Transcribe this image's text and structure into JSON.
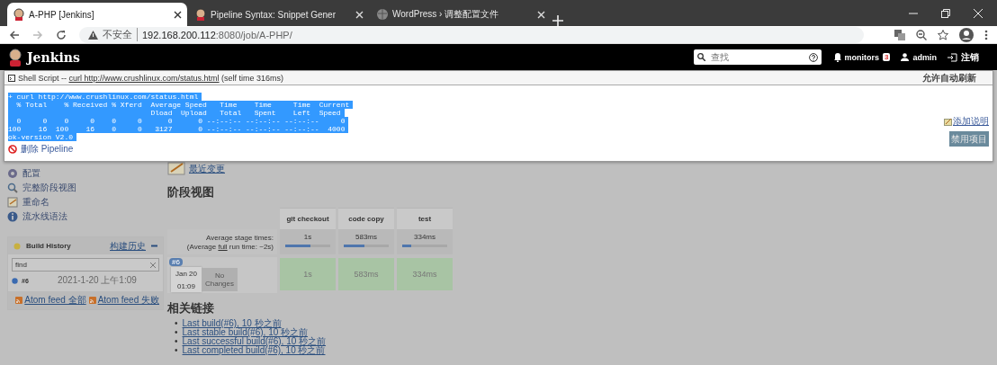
{
  "browser": {
    "tabs": [
      {
        "title": "A-PHP [Jenkins]",
        "selected": true
      },
      {
        "title": "Pipeline Syntax: Snippet Gener",
        "selected": false
      },
      {
        "title": "WordPress › 调整配置文件",
        "selected": false
      }
    ],
    "security": "不安全",
    "url_host": "192.168.200.112",
    "url_rest": ":8080/job/A-PHP/"
  },
  "header": {
    "logo": "Jenkins",
    "search_placeholder": "查找",
    "monitors": "monitors",
    "monitors_count": "3",
    "user": "admin",
    "logout": "注销"
  },
  "modal": {
    "title_prefix": "Shell Script -- ",
    "title_link": "curl http://www.crushlinux.com/status.html",
    "title_suffix": " (self time 316ms)",
    "auto_refresh": "允许自动刷新",
    "log_lines": [
      "+ curl http://www.crushlinux.com/status.html",
      "  % Total    % Received % Xferd  Average Speed   Time    Time     Time  Current",
      "                                 Dload  Upload   Total   Spent    Left  Speed",
      "  0     0    0     0    0     0      0      0 --:--:-- --:--:-- --:--:--     0",
      "100    16  100    16    0     0   3127      0 --:--:-- --:--:-- --:--:--  4000",
      "ok-version V2.0"
    ],
    "delete_link": "删除 Pipeline",
    "add_description": "添加说明",
    "disable_button": "禁用项目"
  },
  "sidebar": {
    "items": [
      {
        "label": "配置"
      },
      {
        "label": "完整阶段视图"
      },
      {
        "label": "重命名"
      },
      {
        "label": "流水线语法"
      }
    ]
  },
  "recent_changes": "最近变更",
  "build_history": {
    "title": "Build History",
    "trend": "构建历史",
    "filter": "find",
    "builds": [
      {
        "number": "#6",
        "time": "2021-1-20 上午1:09"
      }
    ],
    "feeds": [
      "Atom feed 全部",
      "Atom feed 失败"
    ]
  },
  "stage_view": {
    "title": "阶段视图",
    "avg_label": "Average stage times:",
    "avg_prefix": "(Average ",
    "avg_link": "full",
    "avg_suffix": " run time: ~2s)",
    "stages": [
      {
        "name": "git checkout",
        "avg": "1s",
        "level": 0.55
      },
      {
        "name": "code copy",
        "avg": "583ms",
        "level": 0.45
      },
      {
        "name": "test",
        "avg": "334ms",
        "level": 0.2
      }
    ],
    "run": {
      "badge": "#6",
      "date": "Jan 20",
      "time": "01:09",
      "changes": "No Changes",
      "cells": [
        "1s",
        "583ms",
        "334ms"
      ]
    }
  },
  "related": {
    "title": "相关链接",
    "marker": "•",
    "links": [
      "Last build(#6), 10 秒之前",
      "Last stable build(#6), 10 秒之前",
      "Last successful build(#6), 10 秒之前",
      "Last completed build(#6), 10 秒之前"
    ]
  }
}
